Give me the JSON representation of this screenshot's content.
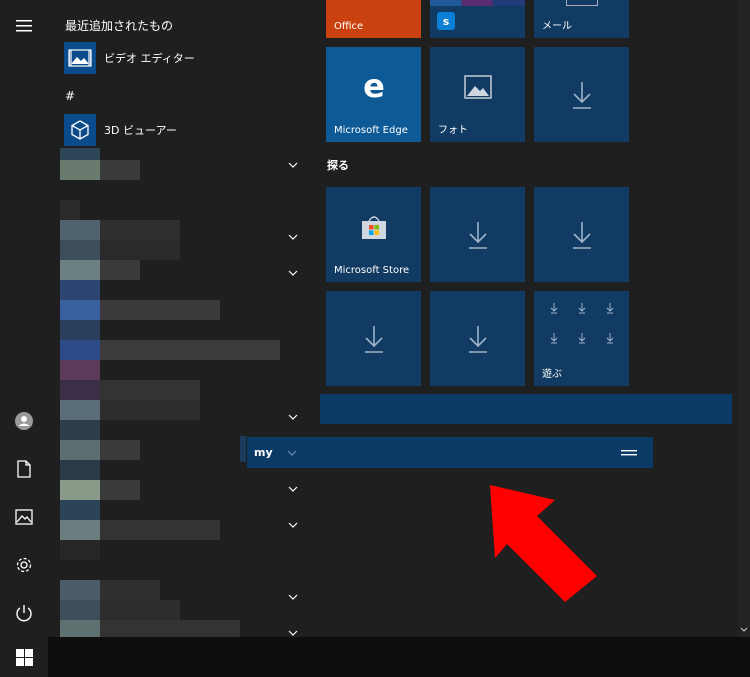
{
  "app_list": {
    "recent_header": "最近追加されたもの",
    "hash_header": "#",
    "items": [
      {
        "label": "ビデオ エディター",
        "icon": "video-editor-icon"
      },
      {
        "label": "3D ビューアー",
        "icon": "cube-3d-icon"
      }
    ]
  },
  "tiles": {
    "row1": [
      "Office",
      "",
      "メール"
    ],
    "row2": [
      "Microsoft Edge",
      "フォト",
      ""
    ],
    "group2_header": "探る",
    "row3": [
      "Microsoft Store",
      "",
      ""
    ],
    "row4": [
      "",
      "",
      "遊ぶ"
    ]
  },
  "group_name_field": {
    "value": "my"
  },
  "colors": {
    "tile": "#123b63",
    "accent_bar": "#0b3a66",
    "office": "#d83b01",
    "arrow": "#ff0000"
  }
}
